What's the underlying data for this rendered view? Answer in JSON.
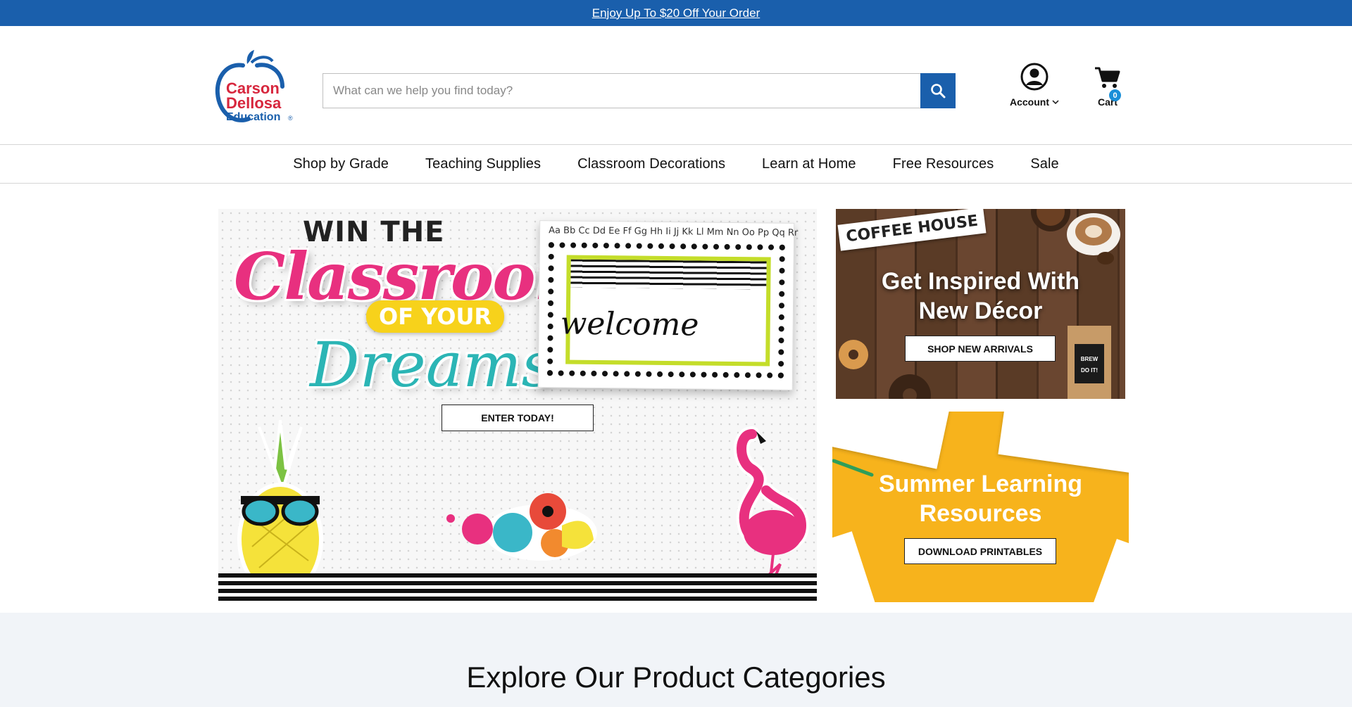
{
  "promo": {
    "text": "Enjoy Up To $20 Off Your Order"
  },
  "logo": {
    "line1": "Carson",
    "line2": "Dellosa",
    "line3": "Education",
    "mark": "®"
  },
  "search": {
    "placeholder": "What can we help you find today?"
  },
  "account": {
    "label": "Account"
  },
  "cart": {
    "label": "Cart",
    "count": "0"
  },
  "nav": {
    "items": [
      "Shop by Grade",
      "Teaching Supplies",
      "Classroom Decorations",
      "Learn at Home",
      "Free Resources",
      "Sale"
    ]
  },
  "hero": {
    "line1": "WIN THE",
    "line2": "Classroom",
    "line3": "OF YOUR",
    "line4": "Dreams",
    "board_alphabet": "Aa Bb Cc Dd Ee Ff Gg Hh Ii Jj Kk Ll Mm Nn Oo Pp Qq Rr",
    "board_word": "welcome",
    "cta": "ENTER TODAY!"
  },
  "coffee_banner": {
    "tag": "COFFEE HOUSE",
    "title_line1": "Get Inspired With",
    "title_line2": "New Décor",
    "cta": "SHOP NEW ARRIVALS",
    "bag_text": "BREW IT DO IT!"
  },
  "summer_banner": {
    "title_line1": "Summer Learning",
    "title_line2": "Resources",
    "cta": "DOWNLOAD PRINTABLES"
  },
  "explore": {
    "heading": "Explore Our Product Categories"
  },
  "colors": {
    "brand_blue": "#1a5fac",
    "brand_red": "#d7263d",
    "summer_orange": "#f7b31c",
    "badge_blue": "#1a8fd8"
  },
  "icons": {
    "search": "search-icon",
    "account": "user-circle-icon",
    "cart": "cart-icon",
    "chevron": "chevron-down-icon"
  }
}
